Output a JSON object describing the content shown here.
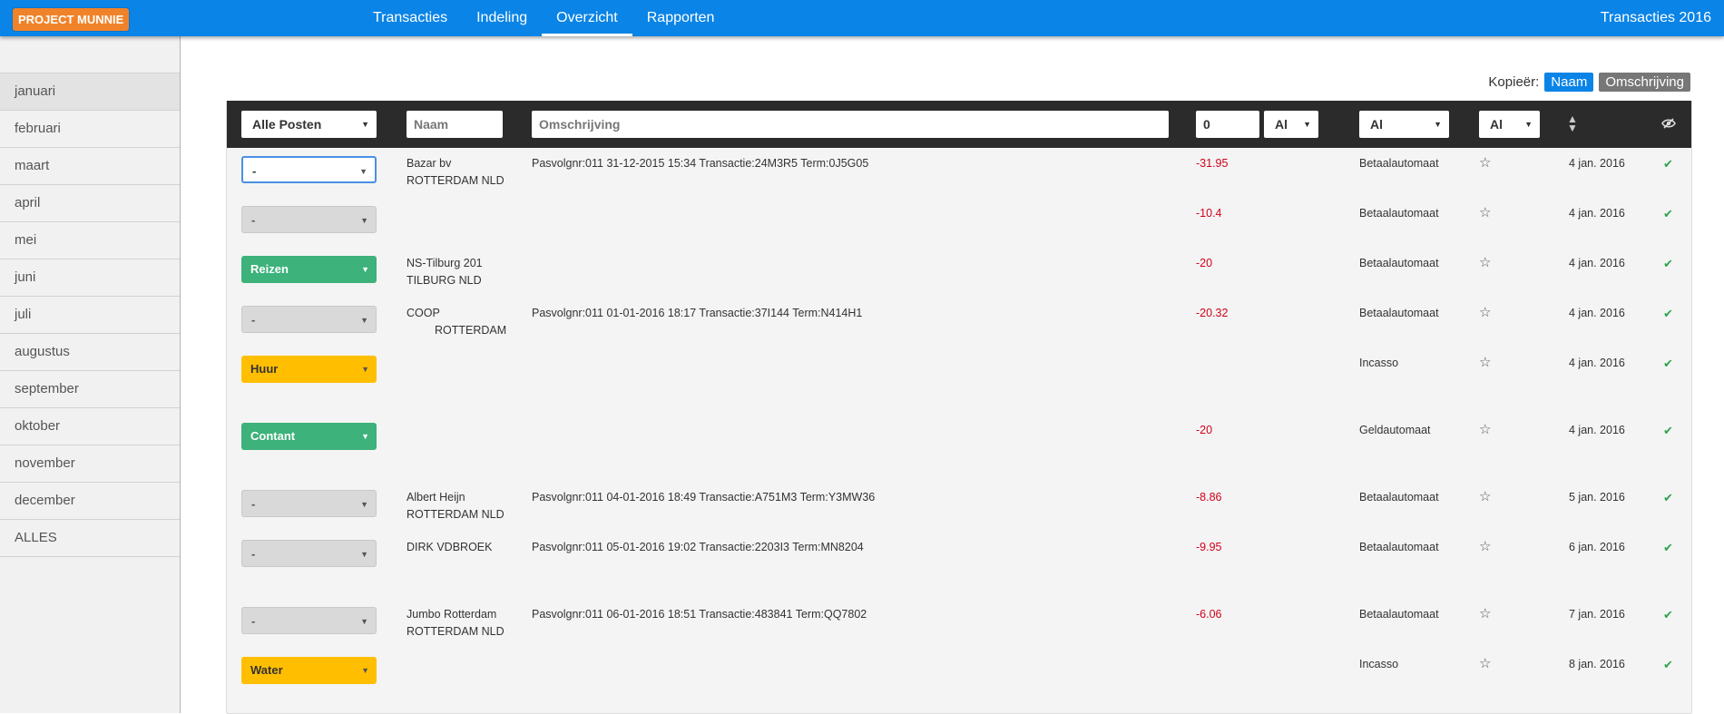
{
  "app": {
    "brand": "PROJECT MUNNIE",
    "right_title": "Transacties 2016"
  },
  "nav": [
    {
      "label": "Transacties"
    },
    {
      "label": "Indeling"
    },
    {
      "label": "Overzicht"
    },
    {
      "label": "Rapporten"
    }
  ],
  "nav_active": "Overzicht",
  "months": [
    "januari",
    "februari",
    "maart",
    "april",
    "mei",
    "juni",
    "juli",
    "augustus",
    "september",
    "oktober",
    "november",
    "december",
    "ALLES"
  ],
  "active_month": "januari",
  "copy": {
    "label": "Kopieër:",
    "naam": "Naam",
    "omschrijving": "Omschrijving"
  },
  "filters": {
    "category": "Alle Posten",
    "naam_placeholder": "Naam",
    "omschrijving_placeholder": "Omschrijving",
    "amount_value": "0",
    "amount_op": "Al",
    "type": "Al",
    "star": "Al"
  },
  "rows": [
    {
      "category": "-",
      "style": "first",
      "name_line1": "Bazar bv",
      "name_line2": "ROTTERDAM NLD",
      "description": "Pasvolgnr:011 31-12-2015 15:34 Transactie:24M3R5 Term:0J5G05",
      "amount": "-31.95",
      "type": "Betaalautomaat",
      "date": "4 jan. 2016"
    },
    {
      "category": "-",
      "style": "none",
      "name_line1": "",
      "name_line2": "",
      "description": "",
      "amount": "-10.4",
      "type": "Betaalautomaat",
      "date": "4 jan. 2016"
    },
    {
      "category": "Reizen",
      "style": "green",
      "name_line1": "NS-Tilburg 201",
      "name_line2": "TILBURG NLD",
      "description": "",
      "amount": "-20",
      "type": "Betaalautomaat",
      "date": "4 jan. 2016"
    },
    {
      "category": "-",
      "style": "none",
      "name_line1": "COOP",
      "name_line2": "ROTTERDAM",
      "description": "Pasvolgnr:011 01-01-2016 18:17 Transactie:37I144 Term:N414H1",
      "amount": "-20.32",
      "type": "Betaalautomaat",
      "date": "4 jan. 2016"
    },
    {
      "category": "Huur",
      "style": "yellow",
      "name_line1": "",
      "name_line2": "",
      "description": "",
      "amount": "",
      "type": "Incasso",
      "date": "4 jan. 2016"
    },
    {
      "category": "Contant",
      "style": "green",
      "name_line1": "",
      "name_line2": "",
      "description": "",
      "amount": "-20",
      "type": "Geldautomaat",
      "date": "4 jan. 2016"
    },
    {
      "category": "-",
      "style": "none",
      "name_line1": "Albert Heijn",
      "name_line2": "ROTTERDAM NLD",
      "description": "Pasvolgnr:011 04-01-2016 18:49 Transactie:A751M3 Term:Y3MW36",
      "amount": "-8.86",
      "type": "Betaalautomaat",
      "date": "5 jan. 2016"
    },
    {
      "category": "-",
      "style": "none",
      "name_line1": "DIRK VDBROEK",
      "name_line2": "",
      "description": "Pasvolgnr:011 05-01-2016 19:02 Transactie:2203I3 Term:MN8204",
      "amount": "-9.95",
      "type": "Betaalautomaat",
      "date": "6 jan. 2016"
    },
    {
      "category": "-",
      "style": "none",
      "name_line1": "Jumbo Rotterdam",
      "name_line2": "ROTTERDAM NLD",
      "description": "Pasvolgnr:011 06-01-2016 18:51 Transactie:483841 Term:QQ7802",
      "amount": "-6.06",
      "type": "Betaalautomaat",
      "date": "7 jan. 2016"
    },
    {
      "category": "Water",
      "style": "yellow",
      "name_line1": "",
      "name_line2": "",
      "description": "",
      "amount": "",
      "type": "Incasso",
      "date": "8 jan. 2016"
    }
  ]
}
